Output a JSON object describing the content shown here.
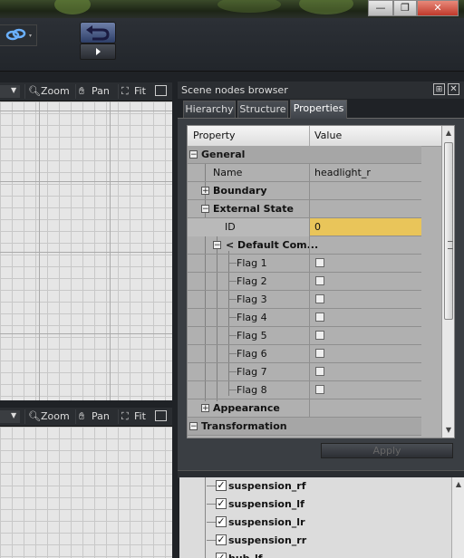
{
  "window": {
    "minimize": "—",
    "maximize": "❐",
    "close": "✕"
  },
  "viewport": {
    "zoom_label": "Zoom",
    "pan_label": "Pan",
    "fit_label": "Fit"
  },
  "panel": {
    "title": "Scene nodes browser",
    "pin": "⊞",
    "close": "✕",
    "tabs": [
      {
        "label": "Hierarchy"
      },
      {
        "label": "Structure"
      },
      {
        "label": "Properties"
      }
    ],
    "active_tab": "Properties"
  },
  "grid": {
    "col_property": "Property",
    "col_value": "Value",
    "rows": [
      {
        "name": "General",
        "value": ""
      },
      {
        "name": "Name",
        "value": "headlight_r"
      },
      {
        "name": "Boundary",
        "value": ""
      },
      {
        "name": "External State",
        "value": ""
      },
      {
        "name": "ID",
        "value": "0"
      },
      {
        "name": "< Default Com...",
        "value": ""
      },
      {
        "name": "Flag 1",
        "checked": false
      },
      {
        "name": "Flag 2",
        "checked": false
      },
      {
        "name": "Flag 3",
        "checked": false
      },
      {
        "name": "Flag 4",
        "checked": false
      },
      {
        "name": "Flag 5",
        "checked": false
      },
      {
        "name": "Flag 6",
        "checked": false
      },
      {
        "name": "Flag 7",
        "checked": false
      },
      {
        "name": "Flag 8",
        "checked": false
      },
      {
        "name": "Appearance",
        "value": ""
      },
      {
        "name": "Transformation",
        "value": ""
      }
    ],
    "selected_row": "ID"
  },
  "apply_label": "Apply",
  "nodes": [
    {
      "label": "suspension_rf",
      "checked": true
    },
    {
      "label": "suspension_lf",
      "checked": true
    },
    {
      "label": "suspension_lr",
      "checked": true
    },
    {
      "label": "suspension_rr",
      "checked": true
    },
    {
      "label": "hub_lf",
      "checked": true
    }
  ],
  "colors": {
    "selected_row": "#e9c55a",
    "category_row": "#a6a6a6",
    "panel_bg": "#3a3e43"
  }
}
